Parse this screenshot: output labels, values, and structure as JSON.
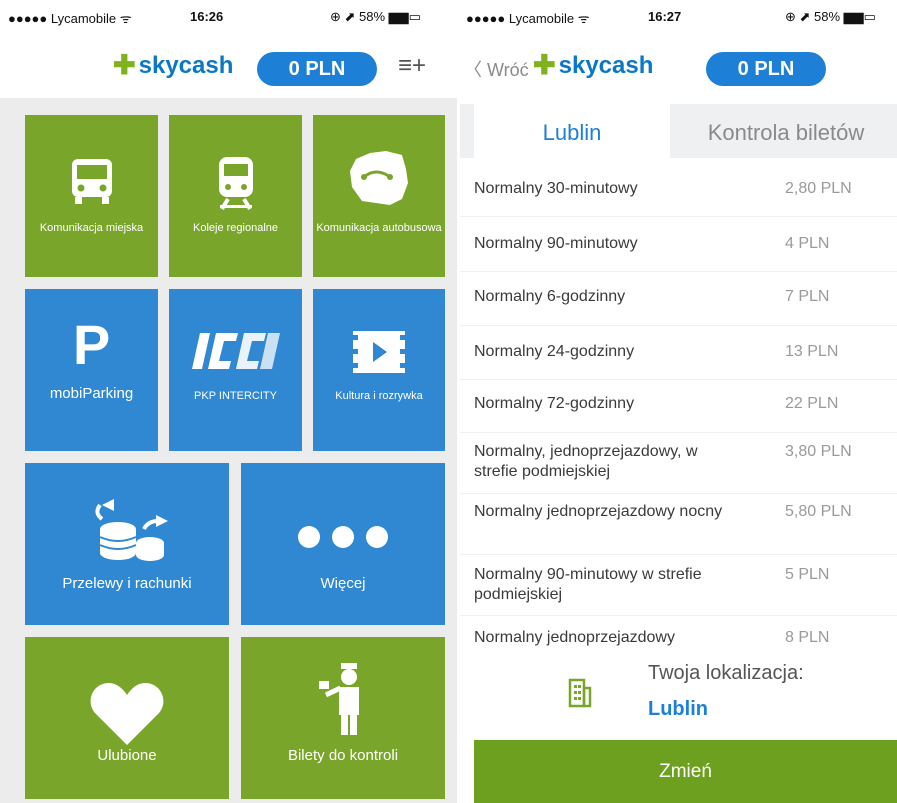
{
  "left_screen": {
    "status": {
      "carrier": "●●●●● Lycamobile ᯤ",
      "time": "16:26",
      "battery": "⊕ ⬈ 58% ▆▆▭"
    },
    "header": {
      "brand": "skycash",
      "balance": "0 PLN",
      "menu_icon": "menu-plus-icon"
    },
    "tiles": [
      {
        "label": "Komunikacja miejska",
        "icon": "bus-icon"
      },
      {
        "label": "Koleje regionalne",
        "icon": "train-icon"
      },
      {
        "label": "Komunikacja autobusowa",
        "icon": "poland-map-icon"
      },
      {
        "label": "mobiParking",
        "icon": "parking-icon",
        "icon_text": "P"
      },
      {
        "label": "PKP INTERCITY",
        "icon": "intercity-logo-icon"
      },
      {
        "label": "Kultura i rozrywka",
        "icon": "film-play-icon"
      },
      {
        "label": "Przelewy i rachunki",
        "icon": "coins-transfer-icon"
      },
      {
        "label": "Więcej",
        "icon": "more-dots-icon"
      },
      {
        "label": "Ulubione",
        "icon": "heart-icon"
      },
      {
        "label": "Bilety do kontroli",
        "icon": "inspector-icon"
      }
    ]
  },
  "right_screen": {
    "status": {
      "carrier": "●●●●● Lycamobile ᯤ",
      "time": "16:27",
      "battery": "⊕ ⬈ 58% ▆▆▭"
    },
    "header": {
      "back": "〈 Wróć",
      "brand": "skycash",
      "balance": "0 PLN"
    },
    "tabs": [
      {
        "label": "Lublin",
        "active": true
      },
      {
        "label": "Kontrola biletów",
        "active": false
      }
    ],
    "tickets": [
      {
        "name": "Normalny 30-minutowy",
        "price": "2,80 PLN"
      },
      {
        "name": "Normalny 90-minutowy",
        "price": "4 PLN"
      },
      {
        "name": "Normalny 6-godzinny",
        "price": "7 PLN"
      },
      {
        "name": "Normalny 24-godzinny",
        "price": "13 PLN"
      },
      {
        "name": "Normalny 72-godzinny",
        "price": "22 PLN"
      },
      {
        "name": "Normalny, jednoprzejazdowy, w strefie podmiejskiej",
        "price": "3,80 PLN"
      },
      {
        "name": "Normalny jednoprzejazdowy nocny",
        "price": "5,80 PLN"
      },
      {
        "name": "Normalny 90-minutowy w strefie podmiejskiej",
        "price": "5 PLN"
      },
      {
        "name": "Normalny jednoprzejazdowy",
        "price": "8 PLN"
      }
    ],
    "location": {
      "label": "Twoja lokalizacja:",
      "city": "Lublin",
      "icon": "building-icon"
    },
    "change_button": "Zmień"
  },
  "colors": {
    "green": "#7aa52b",
    "blue": "#2f88d1",
    "brand": "#0b78c6",
    "accent": "#7fb21c"
  }
}
